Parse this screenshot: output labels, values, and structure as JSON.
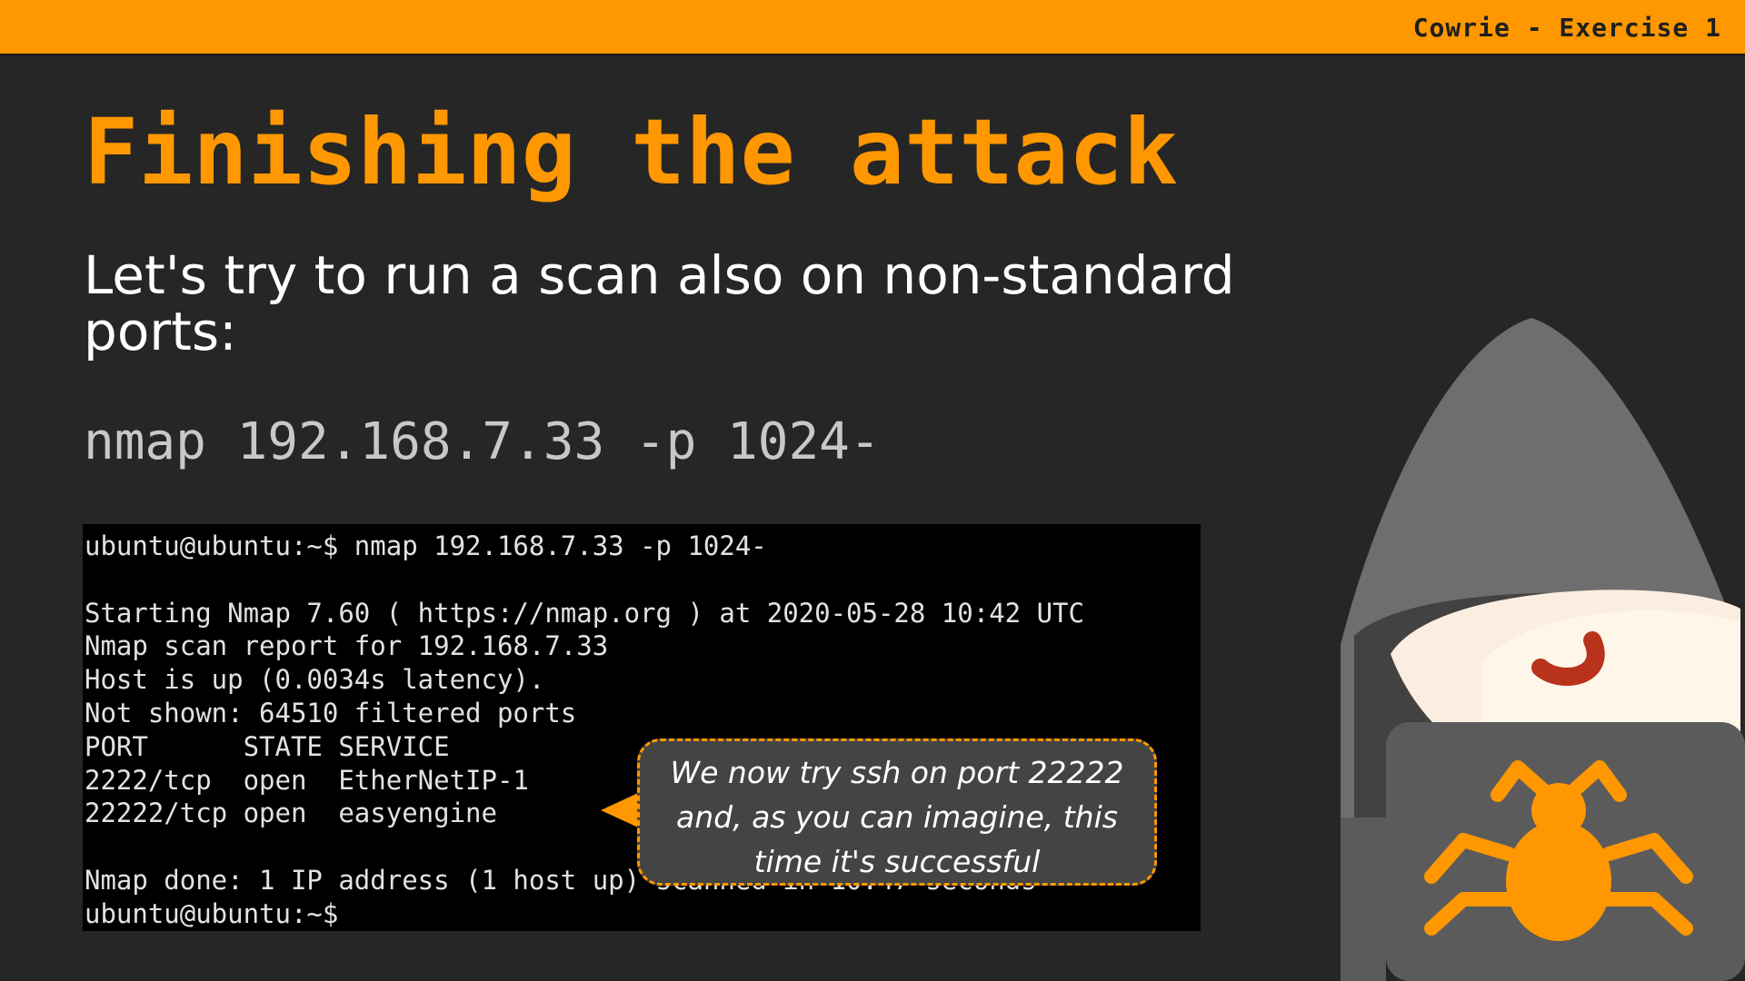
{
  "header": {
    "label": "Cowrie - Exercise 1"
  },
  "slide": {
    "title": "Finishing the attack",
    "subtitle": "Let's try to run a scan also on non-standard ports:",
    "command": "nmap 192.168.7.33 -p 1024-"
  },
  "terminal": {
    "lines": [
      "ubuntu@ubuntu:~$ nmap 192.168.7.33 -p 1024-",
      "",
      "Starting Nmap 7.60 ( https://nmap.org ) at 2020-05-28 10:42 UTC",
      "Nmap scan report for 192.168.7.33",
      "Host is up (0.0034s latency).",
      "Not shown: 64510 filtered ports",
      "PORT      STATE SERVICE",
      "2222/tcp  open  EtherNetIP-1",
      "22222/tcp open  easyengine",
      "",
      "Nmap done: 1 IP address (1 host up) scanned in 10.47 seconds",
      "ubuntu@ubuntu:~$"
    ]
  },
  "callout": {
    "text": "We now try ssh on port 22222 and, as you can imagine, this time it's successful"
  },
  "colors": {
    "accent": "#ff9800",
    "background": "#262626",
    "terminal_bg": "#000000",
    "callout_bg": "#444444"
  },
  "icons": {
    "arrow": "arrow-left-icon",
    "hacker": "hooded-hacker-illustration",
    "bug": "bug-icon"
  }
}
